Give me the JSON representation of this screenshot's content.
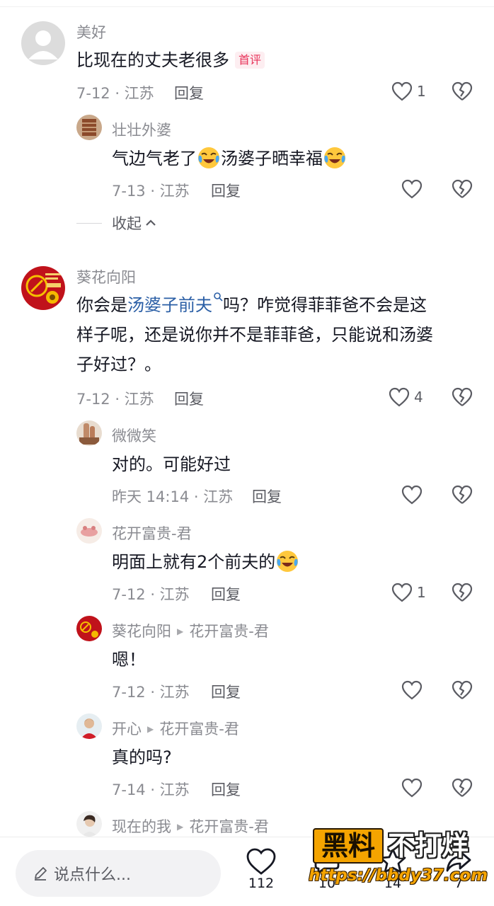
{
  "comments": [
    {
      "user": "美好",
      "text": "比现在的丈夫老很多",
      "badge": "首评",
      "meta": "7-12 · 江苏",
      "reply_label": "回复",
      "likes": "1"
    },
    {
      "user": "壮壮外婆",
      "text_a": "气边气老了",
      "text_b": "汤婆子晒幸福",
      "meta": "7-13 · 江苏",
      "reply_label": "回复"
    },
    {
      "user": "葵花向阳",
      "text_pre": "你会是",
      "text_link": "汤婆子前夫",
      "text_post": "吗？咋觉得菲菲爸不会是这",
      "text_line2": "样子呢，还是说你并不是菲菲爸，只能说和汤婆",
      "text_line3": "子好过？。",
      "meta": "7-12 · 江苏",
      "reply_label": "回复",
      "likes": "4"
    },
    {
      "user": "微微笑",
      "text": "对的。可能好过",
      "meta": "昨天 14:14 · 江苏",
      "reply_label": "回复"
    },
    {
      "user": "花开富贵-君",
      "text": "明面上就有2个前夫的",
      "meta": "7-12 · 江苏",
      "reply_label": "回复",
      "likes": "1"
    },
    {
      "user": "葵花向阳",
      "reply_to": "花开富贵-君",
      "text": "嗯！",
      "meta": "7-12 · 江苏",
      "reply_label": "回复"
    },
    {
      "user": "开心",
      "reply_to": "花开富贵-君",
      "text": "真的吗?",
      "meta": "7-14 · 江苏",
      "reply_label": "回复"
    },
    {
      "user": "现在的我",
      "reply_to": "花开富贵-君"
    }
  ],
  "collapse_label": "收起",
  "bottom": {
    "input_placeholder": "说点什么...",
    "like_count": "112",
    "comment_count": "10",
    "star_count": "14",
    "share_count": "7"
  },
  "watermark": {
    "boxed": "黑料",
    "rest": "不打烊",
    "url": "https://bbdy37.com"
  },
  "colors": {
    "link": "#2b5fa6",
    "badge": "#e8335a",
    "watermark_orange": "#f5a400"
  },
  "icons": [
    "heart-icon",
    "broken-heart-icon",
    "pencil-icon",
    "chevron-up-icon",
    "search-icon",
    "crying-laugh-emoji"
  ]
}
